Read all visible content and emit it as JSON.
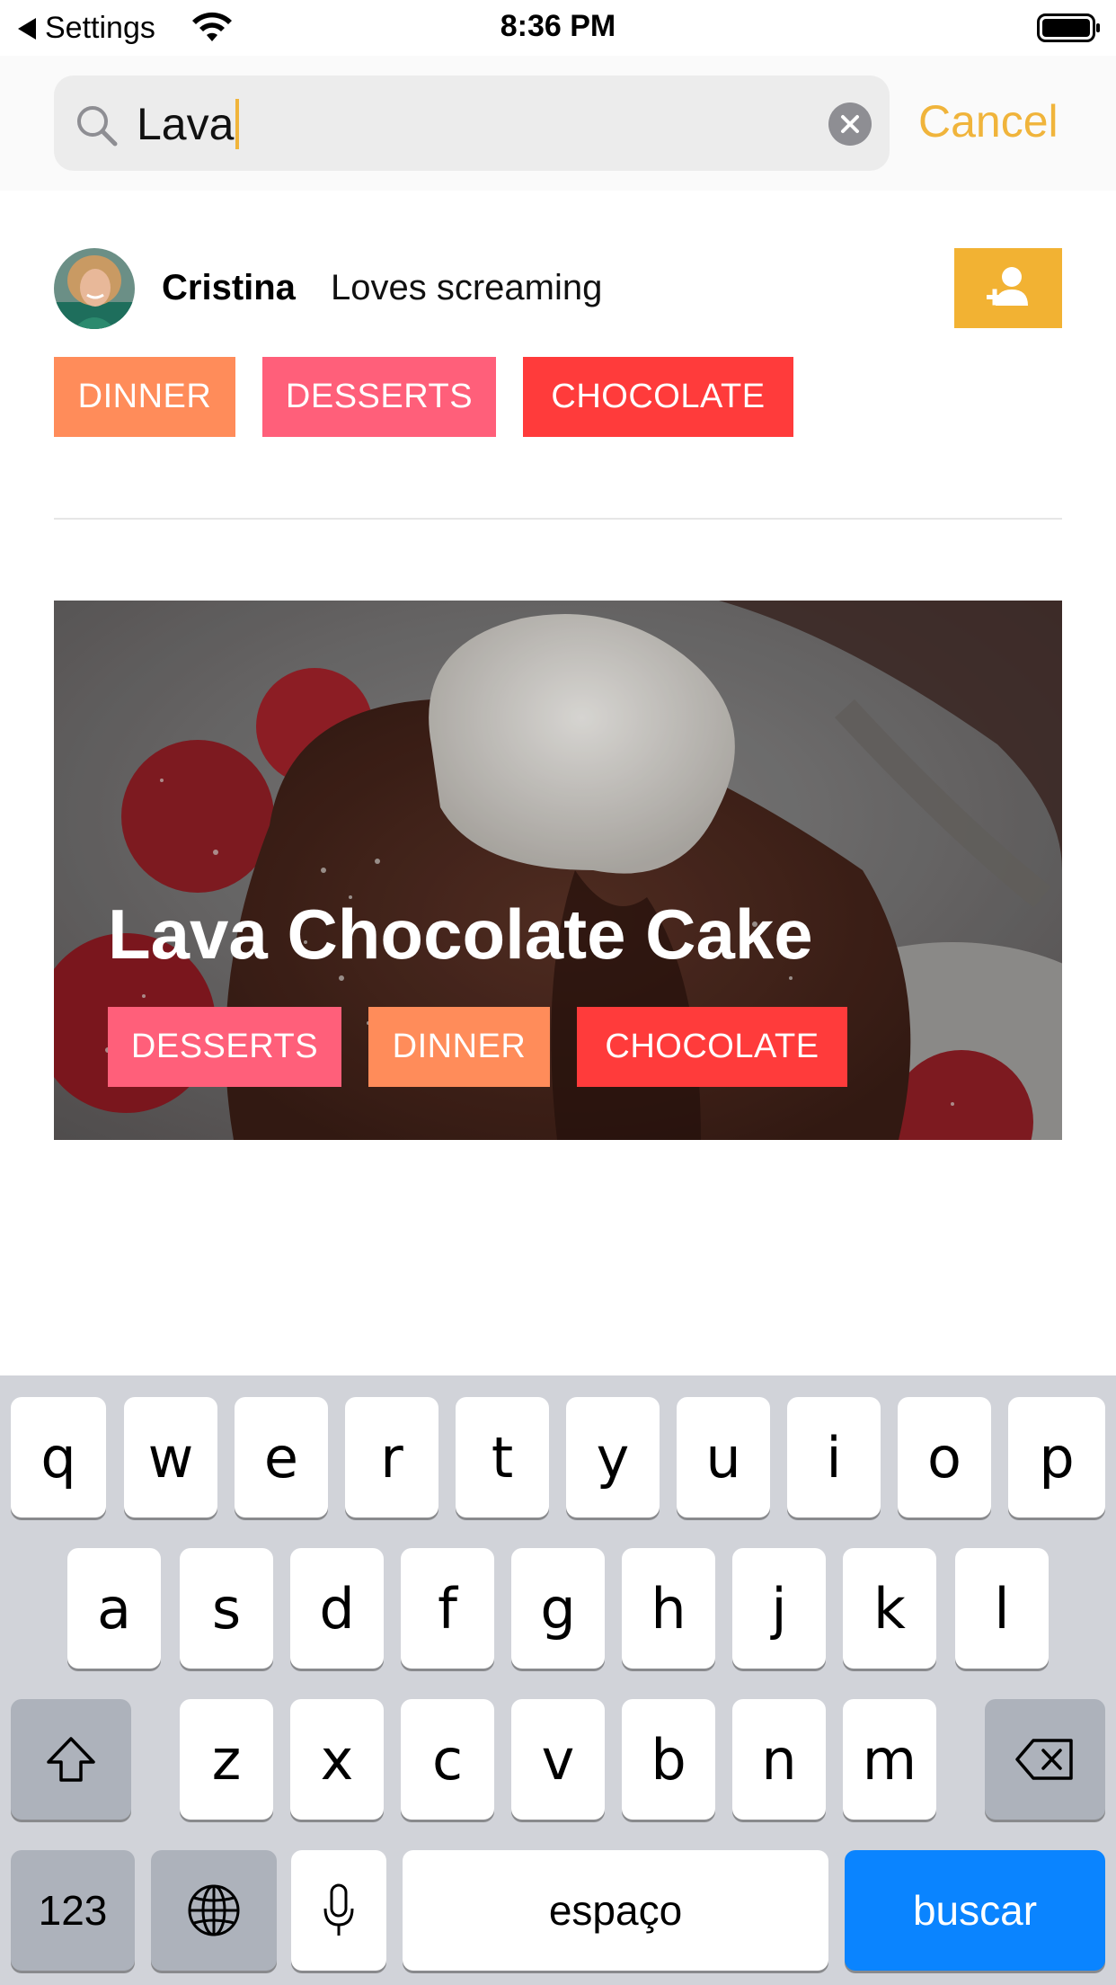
{
  "status_bar": {
    "back_label": "Settings",
    "time": "8:36 PM"
  },
  "search": {
    "query": "Lava",
    "cancel_label": "Cancel"
  },
  "user": {
    "name": "Cristina",
    "bio": "Loves screaming",
    "tags": [
      "DINNER",
      "DESSERTS",
      "CHOCOLATE"
    ]
  },
  "recipe": {
    "title": "Lava Chocolate Cake",
    "tags": [
      "DESSERTS",
      "DINNER",
      "CHOCOLATE"
    ]
  },
  "keyboard": {
    "row1": [
      "q",
      "w",
      "e",
      "r",
      "t",
      "y",
      "u",
      "i",
      "o",
      "p"
    ],
    "row2": [
      "a",
      "s",
      "d",
      "f",
      "g",
      "h",
      "j",
      "k",
      "l"
    ],
    "row3": [
      "z",
      "x",
      "c",
      "v",
      "b",
      "n",
      "m"
    ],
    "numbers_label": "123",
    "space_label": "espaço",
    "return_label": "buscar"
  },
  "colors": {
    "accent": "#f2b233",
    "tag_dinner": "#ff8c5a",
    "tag_desserts": "#ff5f7a",
    "tag_chocolate": "#ff3b3b",
    "keyboard_action": "#0a84ff"
  }
}
